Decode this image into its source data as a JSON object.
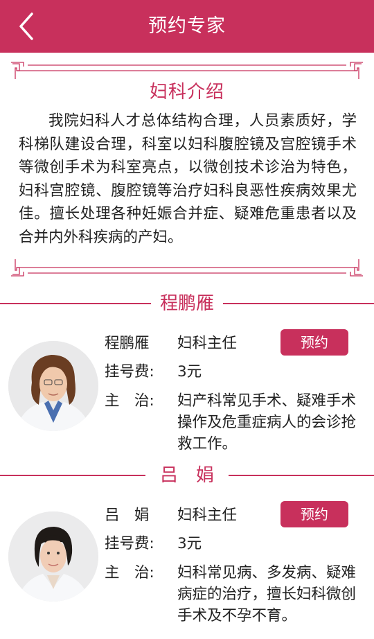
{
  "header": {
    "title": "预约专家"
  },
  "intro": {
    "title": "妇科介绍",
    "text": "我院妇科人才总体结构合理，人员素质好，学科梯队建设合理，科室以妇科腹腔镜及宫腔镜手术等微创手术为科室亮点，以微创技术诊治为特色，妇科宫腔镜、腹腔镜等治疗妇科良恶性疾病效果尤佳。擅长处理各种妊娠合并症、疑难危重患者以及合并内外科疾病的产妇。"
  },
  "labels": {
    "fee": "挂号费:",
    "treats": "主　治:"
  },
  "doctors": [
    {
      "section_name": "程鹏雁",
      "name": "程鹏雁",
      "title": "妇科主任",
      "fee": "3元",
      "specialty": "妇产科常见手术、疑难手术操作及危重症病人的会诊抢救工作。",
      "book_label": "预约"
    },
    {
      "section_name": "吕　娟",
      "name": "吕　娟",
      "title": "妇科主任",
      "fee": "3元",
      "specialty": "妇科常见病、多发病、疑难病症的治疗，擅长妇科微创手术及不孕不育。",
      "book_label": "预约"
    }
  ],
  "colors": {
    "accent": "#c8305c",
    "header_bg": "#c8305c"
  }
}
